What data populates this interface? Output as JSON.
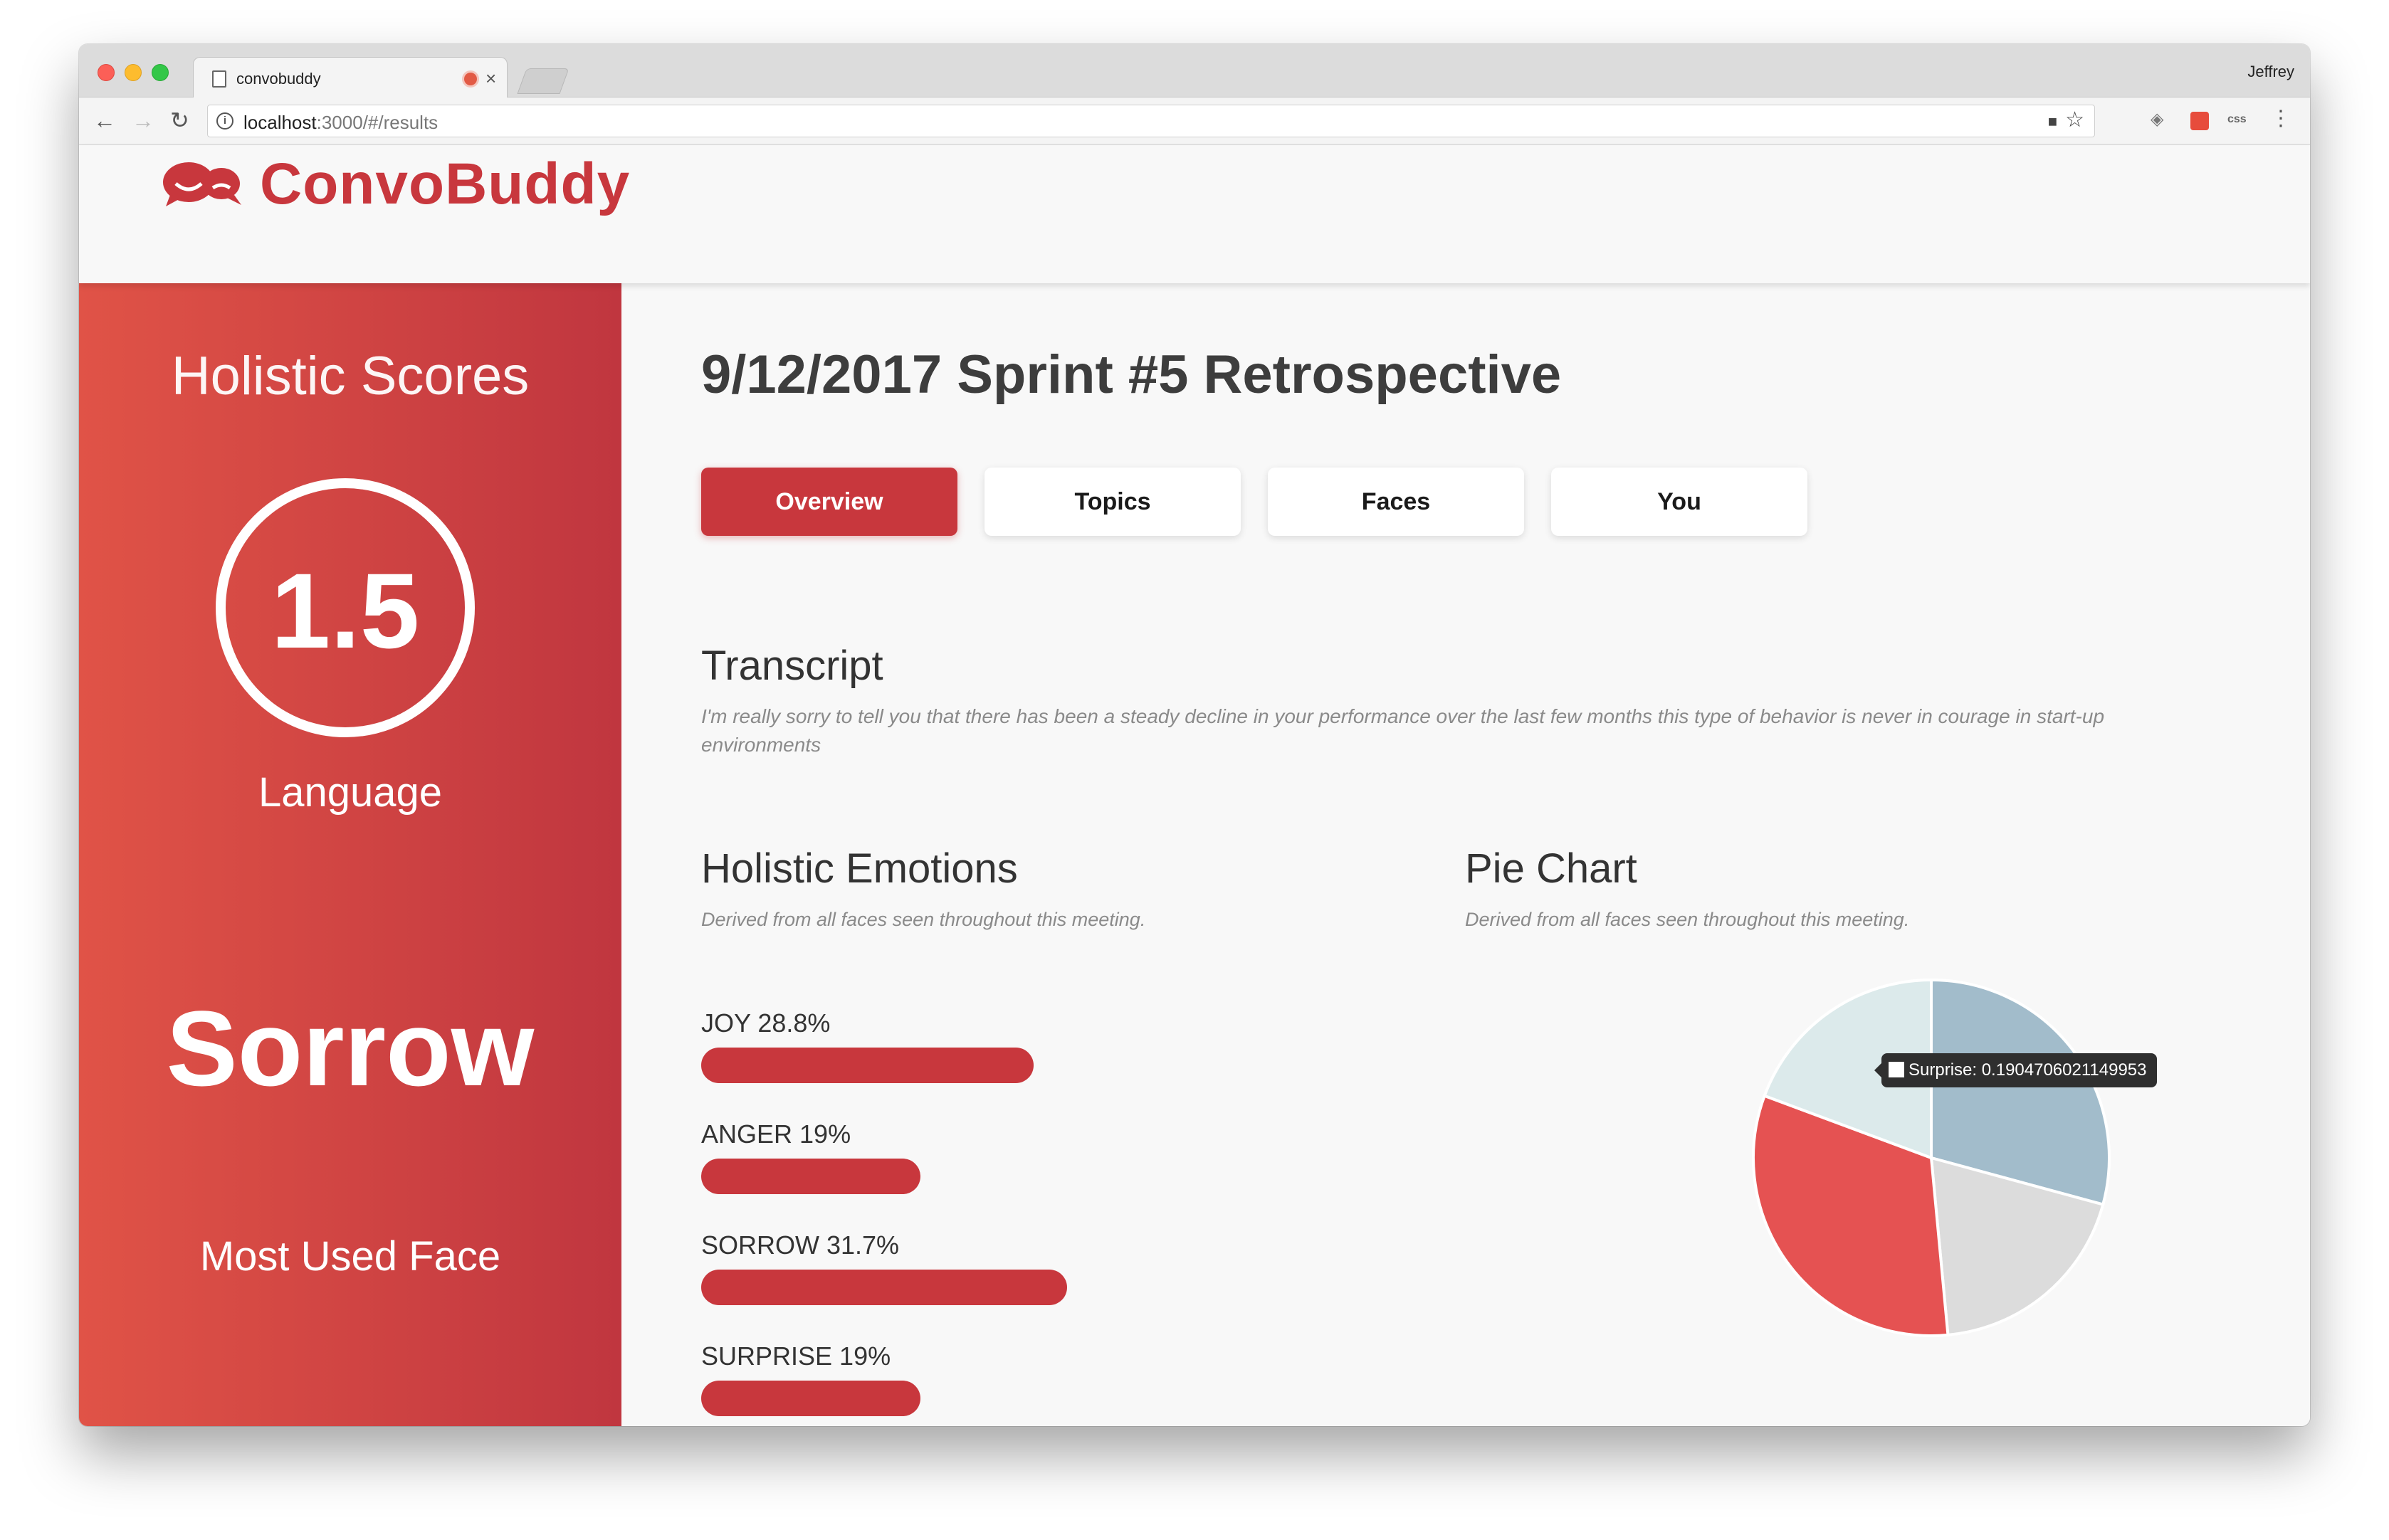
{
  "browser": {
    "tab_title": "convobuddy",
    "profile_name": "Jeffrey",
    "url_host": "localhost",
    "url_rest": ":3000/#/results",
    "ext_css_label": "css"
  },
  "app": {
    "brand": "ConvoBuddy",
    "brand_color": "#c8373d"
  },
  "sidebar": {
    "heading": "Holistic Scores",
    "score": "1.5",
    "score_label": "Language",
    "dominant_emotion": "Sorrow",
    "face_label": "Most Used Face"
  },
  "main": {
    "title": "9/12/2017 Sprint #5 Retrospective",
    "tabs": [
      {
        "label": "Overview",
        "active": true
      },
      {
        "label": "Topics",
        "active": false
      },
      {
        "label": "Faces",
        "active": false
      },
      {
        "label": "You",
        "active": false
      }
    ],
    "transcript": {
      "title": "Transcript",
      "text": "I'm really sorry to tell you that there has been a steady decline in your performance over the last few months this type of behavior is never in courage in start-up environments"
    },
    "emotions": {
      "title": "Holistic Emotions",
      "subtitle": "Derived from all faces seen throughout this meeting.",
      "items": [
        {
          "label": "JOY 28.8%",
          "value": 28.8
        },
        {
          "label": "ANGER 19%",
          "value": 19
        },
        {
          "label": "SORROW 31.7%",
          "value": 31.7
        },
        {
          "label": "SURPRISE 19%",
          "value": 19
        }
      ]
    },
    "pie": {
      "title": "Pie Chart",
      "subtitle": "Derived from all faces seen throughout this meeting.",
      "tooltip": "Surprise: 0.1904706021149953"
    }
  },
  "chart_data": {
    "type": "pie",
    "categories": [
      "Joy",
      "Anger",
      "Sorrow",
      "Surprise"
    ],
    "values": [
      0.288,
      0.19,
      0.317,
      0.1904706021149953
    ],
    "colors": [
      "#a2bccb",
      "#dcdcdc",
      "#e55252",
      "#dceaeb"
    ]
  }
}
